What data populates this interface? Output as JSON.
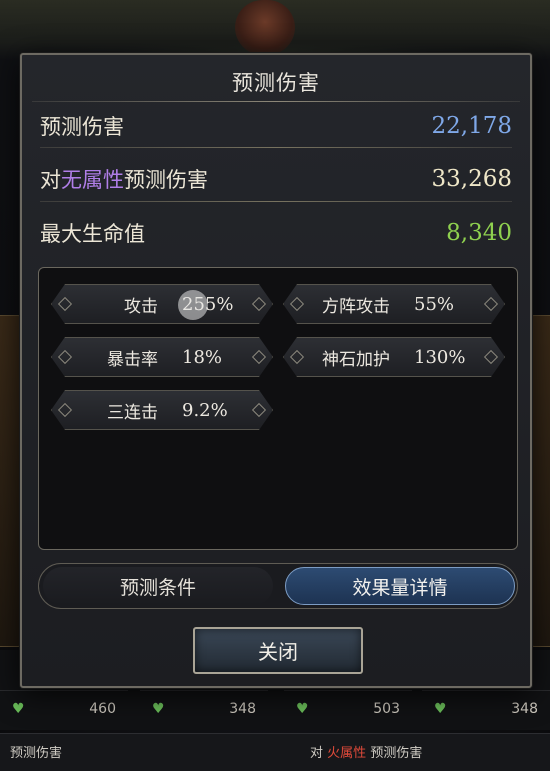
{
  "dialog": {
    "title": "预测伤害",
    "rows": [
      {
        "label": "预测伤害",
        "value": "22,178",
        "value_color": "#7fa8e8"
      },
      {
        "label_prefix": "对",
        "label_accent": "无属性",
        "label_suffix": "预测伤害",
        "accent_color": "#b07ee8",
        "value": "33,268",
        "value_color": "#efe7c8"
      },
      {
        "label": "最大生命值",
        "value": "8,340",
        "value_color": "#8fd14f"
      }
    ]
  },
  "effects": [
    {
      "label": "攻击",
      "value": "255%"
    },
    {
      "label": "方阵攻击",
      "value": "55%"
    },
    {
      "label": "暴击率",
      "value": "18%"
    },
    {
      "label": "神石加护",
      "value": "130%"
    },
    {
      "label": "三连击",
      "value": "9.2%"
    }
  ],
  "tabs": [
    {
      "label": "预测条件",
      "active": false
    },
    {
      "label": "效果量详情",
      "active": true
    }
  ],
  "close_label": "关闭",
  "background": {
    "stats": [
      "460",
      "348",
      "503",
      "348"
    ],
    "bottom_left": "预测伤害",
    "bottom_right_prefix": "对",
    "bottom_right_accent": "火属性",
    "bottom_right_suffix": "预测伤害"
  }
}
